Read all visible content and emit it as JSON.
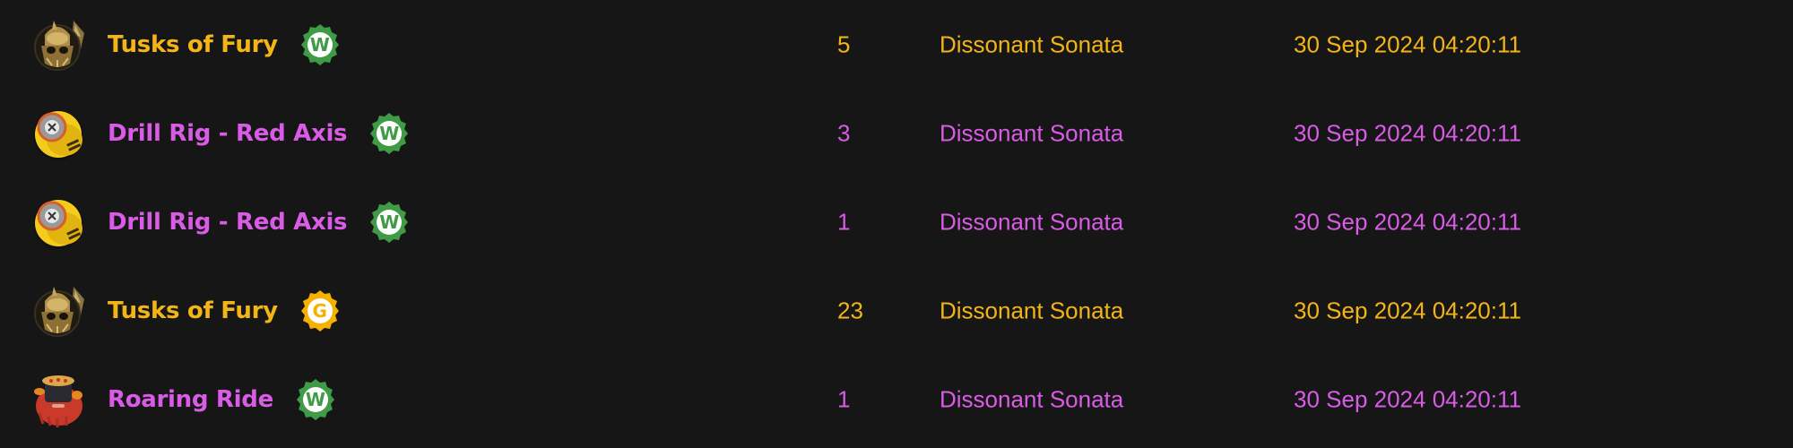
{
  "colors": {
    "gold": "#f2b515",
    "purple": "#d95be6",
    "badge_green": "#3f9b45",
    "badge_gold": "#f5b000",
    "background": "#161616"
  },
  "rows": [
    {
      "item_icon": "tusks-of-fury-helmet-icon",
      "name": "Tusks of Fury",
      "rarity": "gold",
      "badge": {
        "letter": "W",
        "type": "green"
      },
      "quantity": "5",
      "event": "Dissonant Sonata",
      "date": "30 Sep 2024 04:20:11"
    },
    {
      "item_icon": "drill-rig-red-axis-icon",
      "name": "Drill Rig - Red Axis",
      "rarity": "purple",
      "badge": {
        "letter": "W",
        "type": "green"
      },
      "quantity": "3",
      "event": "Dissonant Sonata",
      "date": "30 Sep 2024 04:20:11"
    },
    {
      "item_icon": "drill-rig-red-axis-icon",
      "name": "Drill Rig - Red Axis",
      "rarity": "purple",
      "badge": {
        "letter": "W",
        "type": "green"
      },
      "quantity": "1",
      "event": "Dissonant Sonata",
      "date": "30 Sep 2024 04:20:11"
    },
    {
      "item_icon": "tusks-of-fury-helmet-icon",
      "name": "Tusks of Fury",
      "rarity": "gold",
      "badge": {
        "letter": "G",
        "type": "gold"
      },
      "quantity": "23",
      "event": "Dissonant Sonata",
      "date": "30 Sep 2024 04:20:11"
    },
    {
      "item_icon": "roaring-ride-vehicle-icon",
      "name": "Roaring Ride",
      "rarity": "purple",
      "badge": {
        "letter": "W",
        "type": "green"
      },
      "quantity": "1",
      "event": "Dissonant Sonata",
      "date": "30 Sep 2024 04:20:11"
    }
  ]
}
